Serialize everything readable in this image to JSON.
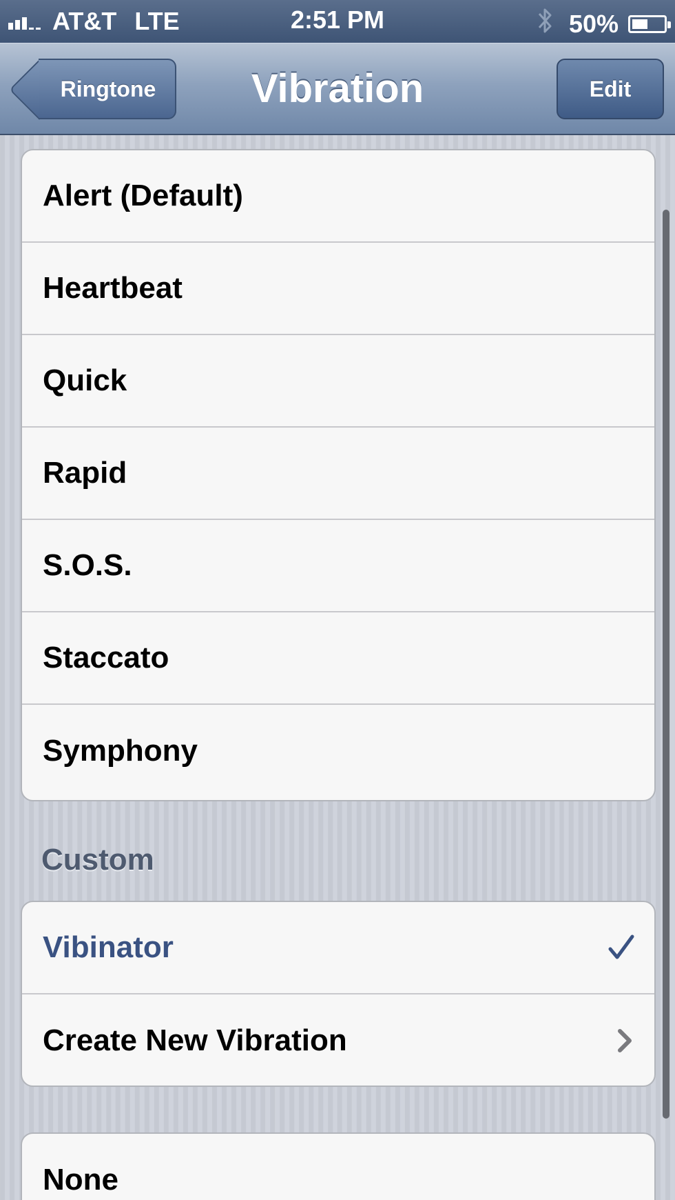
{
  "status_bar": {
    "carrier": "AT&T",
    "network": "LTE",
    "time": "2:51 PM",
    "battery": "50%",
    "battery_level": 0.5,
    "icons": [
      "signal-icon",
      "bluetooth-icon",
      "battery-icon"
    ]
  },
  "nav": {
    "back_label": "Ringtone",
    "title": "Vibration",
    "edit_label": "Edit"
  },
  "standard": {
    "items": [
      {
        "label": "Alert (Default)"
      },
      {
        "label": "Heartbeat"
      },
      {
        "label": "Quick"
      },
      {
        "label": "Rapid"
      },
      {
        "label": "S.O.S."
      },
      {
        "label": "Staccato"
      },
      {
        "label": "Symphony"
      }
    ]
  },
  "custom": {
    "header": "Custom",
    "items": [
      {
        "label": "Vibinator",
        "selected": true,
        "accessory": "checkmark-icon"
      },
      {
        "label": "Create New Vibration",
        "accessory": "chevron-right-icon"
      }
    ]
  },
  "none_group": {
    "items": [
      {
        "label": "None"
      }
    ]
  },
  "colors": {
    "selected_text": "#3a5282",
    "nav_bar": "#8ea2bd",
    "status_bar": "#3e5475"
  }
}
